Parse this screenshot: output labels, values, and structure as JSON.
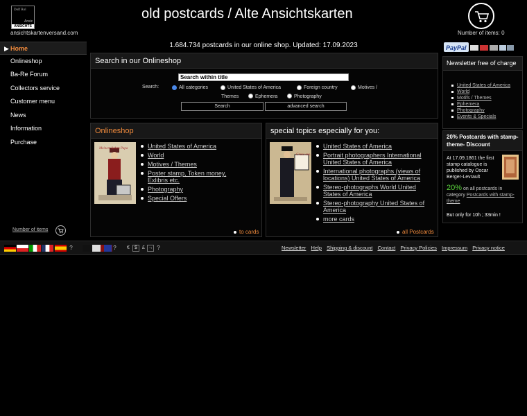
{
  "header": {
    "logo_text_1": "Dolf Rol",
    "logo_text_2": "Ansic",
    "logo_bar": "ANSICHTS",
    "domain": "ansichtskartenversand.com",
    "title": "old postcards / Alte Ansichtskarten",
    "cart_label": "Number of items: 0"
  },
  "sidebar": {
    "items": [
      {
        "label": "Home",
        "active": true
      },
      {
        "label": "Onlineshop"
      },
      {
        "label": "Ba-Re Forum"
      },
      {
        "label": "Collectors service"
      },
      {
        "label": "Customer menu"
      },
      {
        "label": "News"
      },
      {
        "label": "Information"
      },
      {
        "label": "Purchase"
      }
    ],
    "active_arrow": "▶",
    "number_of_items": "Number of items"
  },
  "stats": "1.684.734 postcards in our online shop. Updated: 17.09.2023",
  "search": {
    "heading": "Search in our Onlineshop",
    "input_value": "Search within title",
    "label": "Search:",
    "options": [
      "All categories",
      "United States of America",
      "Foreign country",
      "Motives /",
      "Themes",
      "Ephemera",
      "Photography"
    ],
    "selected": "All categories",
    "search_button": "Search",
    "advanced_button": "advanced search"
  },
  "onlineshop": {
    "heading": "Onlineshop",
    "links": [
      "United States of America",
      "World",
      "Motives / Themes",
      "Poster stamp, Token money, Exlibris etc.",
      "Photography",
      "Special Offers"
    ],
    "more": "to cards",
    "thumb_caption": "Meinem lieben Papa"
  },
  "topics": {
    "heading": "special topics especially for you:",
    "links": [
      "United States of America",
      "Portrait photographers International United States of America",
      "International photographs (views of locations) United States of America",
      "Stereo-photographs World United States of America",
      "Stereo-photography United States of America",
      "more cards"
    ],
    "more": "all Postcards",
    "thumb_caption": "Gruss aus..."
  },
  "payment": {
    "paypal": "PayPal"
  },
  "newsletter": {
    "heading": "Newsletter free of charge",
    "links": [
      "United States of America",
      "World",
      "Motifs / Themes",
      "Ephemera",
      "Photography",
      "Events & Specials"
    ]
  },
  "discount": {
    "heading": "20% Postcards with stamp-theme- Discount",
    "story": "At 17.09.1861 the first stamp catalogue is published by Oscar Berger-Levrault",
    "percent": "20%",
    "text_before": "on all postcards in category",
    "link": "Postcards with stamp-theme",
    "time": "But only for 10h ; 33min !"
  },
  "footer": {
    "question": "?",
    "currencies": [
      "€",
      "$",
      "£",
      "→"
    ],
    "links": [
      "Newsletter",
      "Help",
      "Shipping & discount",
      "Contact",
      "Privacy Policies",
      "Impressum",
      "Privacy notice"
    ]
  },
  "colors": {
    "accent": "#f08a3c",
    "green": "#5bd33d",
    "radio": "#4a88e8"
  }
}
